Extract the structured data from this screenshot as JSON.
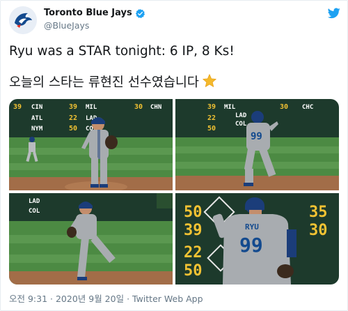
{
  "account": {
    "display_name": "Toronto Blue Jays",
    "handle": "@BlueJays",
    "verified": true,
    "avatar_icon": "blue-jays-logo-icon"
  },
  "tweet": {
    "line1": "Ryu was a STAR tonight: 6 IP, 8 Ks!",
    "line2": "오늘의 스타는 류현진 선수였습니다",
    "emoji": "star-emoji-icon"
  },
  "photos": {
    "board_a": {
      "row1": "CIN",
      "row1_score": "39",
      "row1_team2": "MIL",
      "row1_score2": "30",
      "row1_team3": "CHN",
      "row2": "ATL",
      "row2_score": "22",
      "row2_team2": "LAD",
      "row3": "NYM",
      "row3_score": "50",
      "row3_team2": "COL"
    },
    "board_b": {
      "row1_score": "39",
      "row1_team": "MIL",
      "row1_score2": "30",
      "row1_team2": "CHC",
      "row2_score": "22",
      "row2_team": "LAD",
      "row3_score": "50",
      "row3_team": "COL"
    },
    "board_c": {
      "row1": "LAD",
      "row2": "COL"
    },
    "board_d": {
      "left1": "50",
      "left2": "39",
      "left3": "22",
      "left4": "50",
      "right1": "35",
      "right2": "30"
    },
    "jersey_name": "RYU",
    "jersey_number": "99"
  },
  "meta": {
    "time": "오전 9:31",
    "separator": " · ",
    "date": "2020년 9월 20일",
    "source": "Twitter Web App"
  },
  "colors": {
    "twitter_blue": "#1da1f2",
    "text_secondary": "#657786",
    "board_green": "#1d3a2c",
    "board_yellow": "#f2c233",
    "field_green": "#3f7f3a",
    "jersey_grey": "#a8acb0",
    "jays_blue": "#134a8e"
  }
}
